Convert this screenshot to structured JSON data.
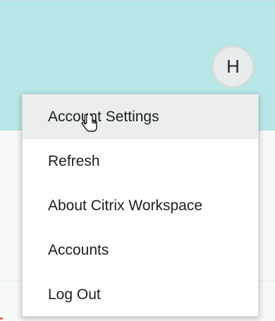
{
  "header": {
    "avatar_initial": "H",
    "accent_color": "#b7e7e7"
  },
  "menu": {
    "items": [
      {
        "label": "Account Settings",
        "hovered": true
      },
      {
        "label": "Refresh"
      },
      {
        "label": "About Citrix Workspace"
      },
      {
        "label": "Accounts"
      },
      {
        "label": "Log Out"
      }
    ]
  },
  "cursor": {
    "icon": "hand-pointer-icon"
  }
}
